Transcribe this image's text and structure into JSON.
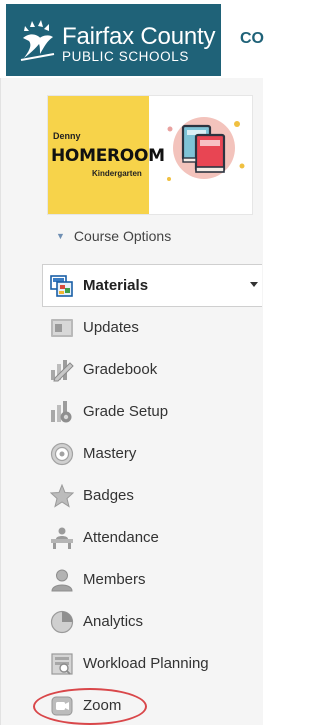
{
  "header": {
    "logo_line1": "Fairfax County",
    "logo_line2": "PUBLIC SCHOOLS",
    "cut_title": "CO"
  },
  "course_card": {
    "teacher": "Denny",
    "title": "HOMEROOM",
    "subtitle": "Kindergarten"
  },
  "course_options": {
    "label": "Course Options"
  },
  "nav": {
    "items": [
      {
        "label": "Materials",
        "icon": "materials-icon",
        "selected": true
      },
      {
        "label": "Updates",
        "icon": "updates-icon"
      },
      {
        "label": "Gradebook",
        "icon": "gradebook-icon"
      },
      {
        "label": "Grade Setup",
        "icon": "grade-setup-icon"
      },
      {
        "label": "Mastery",
        "icon": "mastery-icon"
      },
      {
        "label": "Badges",
        "icon": "badges-icon"
      },
      {
        "label": "Attendance",
        "icon": "attendance-icon"
      },
      {
        "label": "Members",
        "icon": "members-icon"
      },
      {
        "label": "Analytics",
        "icon": "analytics-icon"
      },
      {
        "label": "Workload Planning",
        "icon": "workload-planning-icon"
      },
      {
        "label": "Zoom",
        "icon": "zoom-icon",
        "highlighted": true
      }
    ]
  },
  "colors": {
    "brand": "#1f6278",
    "highlight_ring": "#d9474a",
    "card_yellow": "#f7d34a"
  }
}
